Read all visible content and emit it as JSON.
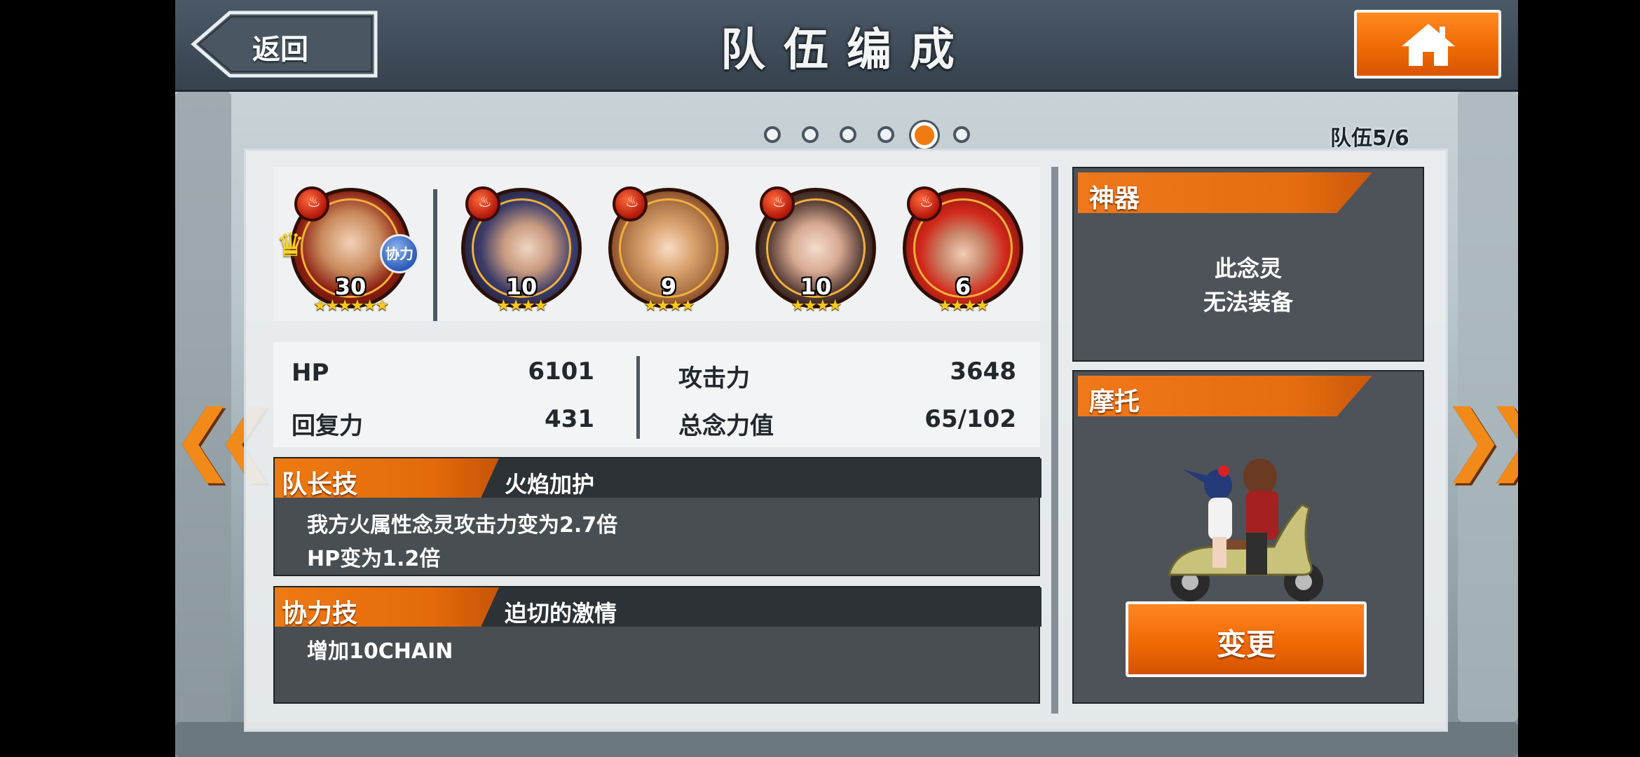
{
  "header": {
    "title": "队伍编成",
    "back_label": "返回"
  },
  "pagination": {
    "total": 6,
    "current": 5,
    "team_label": "队伍5/6"
  },
  "party": [
    {
      "level": "30",
      "stars": "★★★★★★",
      "leader": true,
      "badge": "协力",
      "element": "fire-icon"
    },
    {
      "level": "10",
      "stars": "★★★★",
      "element": "fire-icon"
    },
    {
      "level": "9",
      "stars": "★★★★",
      "element": "fire-icon"
    },
    {
      "level": "10",
      "stars": "★★★★",
      "element": "fire-icon"
    },
    {
      "level": "6",
      "stars": "★★★★",
      "element": "fire-icon"
    }
  ],
  "stats": {
    "hp_label": "HP",
    "hp_value": "6101",
    "recovery_label": "回复力",
    "recovery_value": "431",
    "attack_label": "攻击力",
    "attack_value": "3648",
    "total_label": "总念力值",
    "total_value": "65/102"
  },
  "leader_skill": {
    "tag": "队长技",
    "name": "火焰加护",
    "desc_line1": "我方火属性念灵攻击力变为2.7倍",
    "desc_line2": "HP变为1.2倍"
  },
  "assist_skill": {
    "tag": "协力技",
    "name": "迫切的激情",
    "desc_line1": "增加10CHAIN"
  },
  "artifact": {
    "tag": "神器",
    "msg_line1": "此念灵",
    "msg_line2": "无法装备"
  },
  "motorbike": {
    "tag": "摩托",
    "change_label": "变更"
  },
  "nav": {
    "prev_glyph": "❮❮",
    "next_glyph": "❯❯"
  },
  "colors": {
    "accent_orange": "#f06a05",
    "panel_dark": "#32383c",
    "fire": "#b3170a",
    "star": "#f8c91e"
  }
}
